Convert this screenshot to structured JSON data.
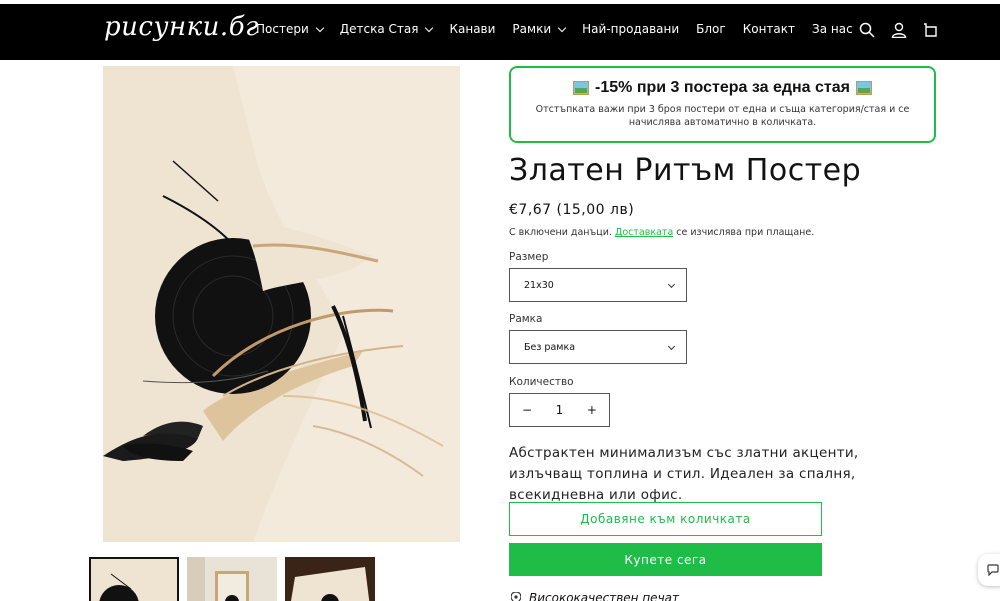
{
  "header": {
    "logo": "рисунки.бг",
    "nav": [
      {
        "label": "Постери",
        "dropdown": true
      },
      {
        "label": "Детска Стая",
        "dropdown": true
      },
      {
        "label": "Канави",
        "dropdown": false
      },
      {
        "label": "Рамки",
        "dropdown": true
      },
      {
        "label": "Най-продавани",
        "dropdown": false
      },
      {
        "label": "Блог",
        "dropdown": false
      },
      {
        "label": "Контакт",
        "dropdown": false
      },
      {
        "label": "За нас",
        "dropdown": false
      }
    ],
    "icons": [
      "search-icon",
      "account-icon",
      "cart-icon"
    ]
  },
  "promo": {
    "title": "-15% при 3 постера за една стая",
    "text": "Отстъпката важи при 3 броя постери от една и съща категория/стая и се начислява автоматично в количката.",
    "icon": "framed-picture-icon"
  },
  "product": {
    "title": "Златен Ритъм Постер",
    "price": "€7,67 (15,00 лв)",
    "tax_prefix": "С включени данъци.",
    "tax_link": "Доставката",
    "tax_suffix": "се изчислява при плащане.",
    "size_label": "Размер",
    "size_value": "21x30",
    "frame_label": "Рамка",
    "frame_value": "Без рамка",
    "qty_label": "Количество",
    "qty_value": "1",
    "qty_minus": "−",
    "qty_plus": "+",
    "description": "Абстрактен минимализъм със златни акценти, излъчващ топлина и стил. Идеален за спалня, всекидневна или офис.",
    "add_to_cart": "Добавяне към количката",
    "buy_now": "Купете сега",
    "feature_1": "Висококачествен печат"
  },
  "colors": {
    "accent": "#1fbd48",
    "header_bg": "#000000",
    "poster_bg": "#efe4d2"
  }
}
